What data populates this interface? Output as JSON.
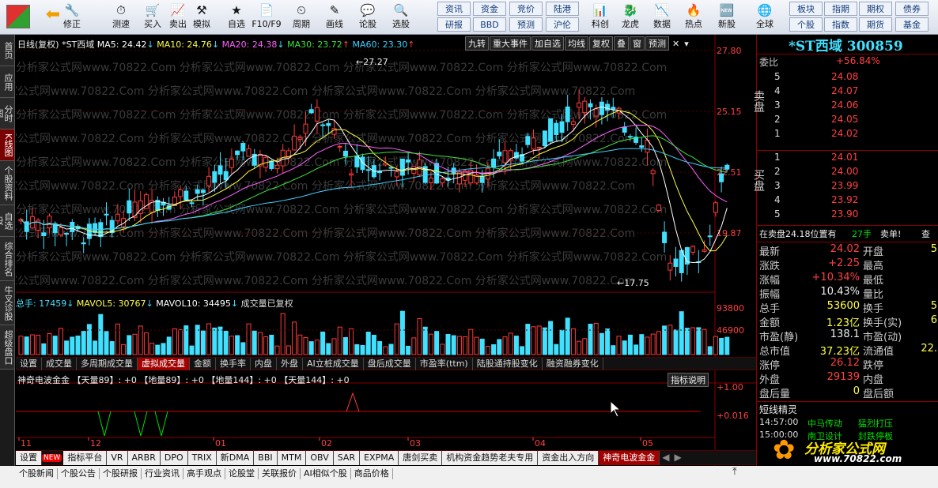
{
  "toolbar": {
    "buttons": [
      "修正",
      "测速",
      "买入",
      "卖出",
      "模拟",
      "自选",
      "F10/F9",
      "周期",
      "画线",
      "论股",
      "选股",
      "科创",
      "龙虎",
      "数据",
      "热点",
      "新股",
      "全球"
    ],
    "small": [
      "资讯",
      "资金",
      "竞价",
      "陆港",
      "研报",
      "BBD",
      "预测",
      "沪伦",
      "板块",
      "指期",
      "期权",
      "债券",
      "个股",
      "指数",
      "期货",
      "基金"
    ]
  },
  "left_tabs": [
    "首页",
    "应用",
    "分时图",
    "K线图",
    "个股资料",
    "自选股",
    "综合排名",
    "牛叉诊股",
    "超级盘口"
  ],
  "chart": {
    "header": "日线(复权) *ST西域",
    "ma5": "MA5: 24.42",
    "ma10": "MA10: 24.76",
    "ma20": "MA20: 24.38",
    "ma30": "MA30: 23.72",
    "ma60": "MA60: 23.30",
    "high_label": "27.27",
    "low_label": "17.75",
    "y_labels": [
      "27.80",
      "25.15",
      "22.51",
      "19.87"
    ],
    "vol_y_labels": [
      "93800",
      "46900"
    ],
    "ind_y_labels": [
      "+1.00",
      "+0.016"
    ],
    "x_labels": [
      "11",
      "12",
      "01",
      "02",
      "03",
      "04",
      "05"
    ],
    "buttons": [
      "九转",
      "重大事件",
      "加自选",
      "均线",
      "复权",
      "叠",
      "窗",
      "预测"
    ],
    "vol_header": "总手: 17459",
    "mavol5": "MAVOL5: 30767",
    "mavol10": "MAVOL10: 34495",
    "vol_note": "成交量已复权",
    "sub_tabs": [
      "设置",
      "成交量",
      "多周期成交量",
      "虚拟成交量",
      "金额",
      "换手率",
      "内盘",
      "外盘",
      "AI立桩成交量",
      "盘后成交量",
      "市盈率(ttm)",
      "陆股通持股变化",
      "融资融券变化"
    ],
    "sub_active": "虚拟成交量",
    "ind_header": "神奇电波金金 【天量89】: +0 【地量89】: +0 【地量144】: +0 【天量144】: +0",
    "ind_help": "指标说明",
    "ind_tabs": [
      "设置",
      "指标平台",
      "VR",
      "ARBR",
      "DPO",
      "TRIX",
      "新DMA",
      "BBI",
      "MTM",
      "OBV",
      "SAR",
      "EXPMA",
      "唐剑买卖",
      "机构资金趋势老夫专用",
      "资金出入方向",
      "神奇电波金金"
    ],
    "ind_active": "神奇电波金金",
    "watermark": "分析家公式网www.70822.Com"
  },
  "right": {
    "title": "*ST西域 300859",
    "weibi_label": "委比",
    "weibi": "+56.84%",
    "sell_label": "卖盘",
    "buy_label": "买盘",
    "sell": [
      {
        "lvl": "5",
        "price": "24.08"
      },
      {
        "lvl": "4",
        "price": "24.07"
      },
      {
        "lvl": "3",
        "price": "24.06"
      },
      {
        "lvl": "2",
        "price": "24.05"
      },
      {
        "lvl": "1",
        "price": "24.02"
      }
    ],
    "buy": [
      {
        "lvl": "1",
        "price": "24.01"
      },
      {
        "lvl": "2",
        "price": "24.00"
      },
      {
        "lvl": "3",
        "price": "23.99"
      },
      {
        "lvl": "4",
        "price": "23.92"
      },
      {
        "lvl": "5",
        "price": "23.90"
      }
    ],
    "notice": "在卖盘24.18位置有",
    "notice_vol": "27手",
    "notice_act": "卖单!",
    "notice_btn": "查",
    "stats": [
      {
        "l": "最新",
        "v": "24.02",
        "c": "red",
        "r": "开盘"
      },
      {
        "l": "涨跌",
        "v": "+2.25",
        "c": "red",
        "r": "最高"
      },
      {
        "l": "涨幅",
        "v": "+10.34%",
        "c": "red",
        "r": "最低"
      },
      {
        "l": "振幅",
        "v": "10.43%",
        "c": "wht",
        "r": "量比"
      },
      {
        "l": "总手",
        "v": "53600",
        "c": "yel",
        "r": "换手"
      },
      {
        "l": "金额",
        "v": "1.23亿",
        "c": "yel",
        "r": "换手(实)"
      },
      {
        "l": "市盈(静)",
        "v": "138.1",
        "c": "wht",
        "r": "市盈(动)"
      },
      {
        "l": "总市值",
        "v": "37.23亿",
        "c": "yel",
        "r": "流通值"
      },
      {
        "l": "涨停",
        "v": "26.12",
        "c": "red",
        "r": "跌停"
      },
      {
        "l": "外盘",
        "v": "29139",
        "c": "red",
        "r": "内盘"
      },
      {
        "l": "盘后量",
        "v": "0",
        "c": "yel",
        "r": "盘后额"
      }
    ],
    "r_right_vals": [
      "5",
      "",
      "",
      "",
      "5",
      "6",
      "",
      "22.",
      "",
      "",
      ""
    ],
    "genie_title": "短线精灵",
    "genie": [
      {
        "t": "14:57:00",
        "n": "中马传动",
        "e": "猛烈打压"
      },
      {
        "t": "15:00:00",
        "n": "南卫设计",
        "e": "封跌停板"
      }
    ],
    "logo": "分析家公式网",
    "logo_url": "www.70822.com"
  },
  "bottom_tabs": [
    "个股新闻",
    "个股公告",
    "个股研报",
    "行业资讯",
    "高手观点",
    "论股堂",
    "关联报价",
    "AI相似个股",
    "商品价格"
  ],
  "colors": {
    "up": "#ff3a3a",
    "down": "#40e0ff",
    "ma5": "#ffffff",
    "ma10": "#ffff40",
    "ma20": "#ff60ff",
    "ma30": "#40e040",
    "ma60": "#40d0ff"
  }
}
